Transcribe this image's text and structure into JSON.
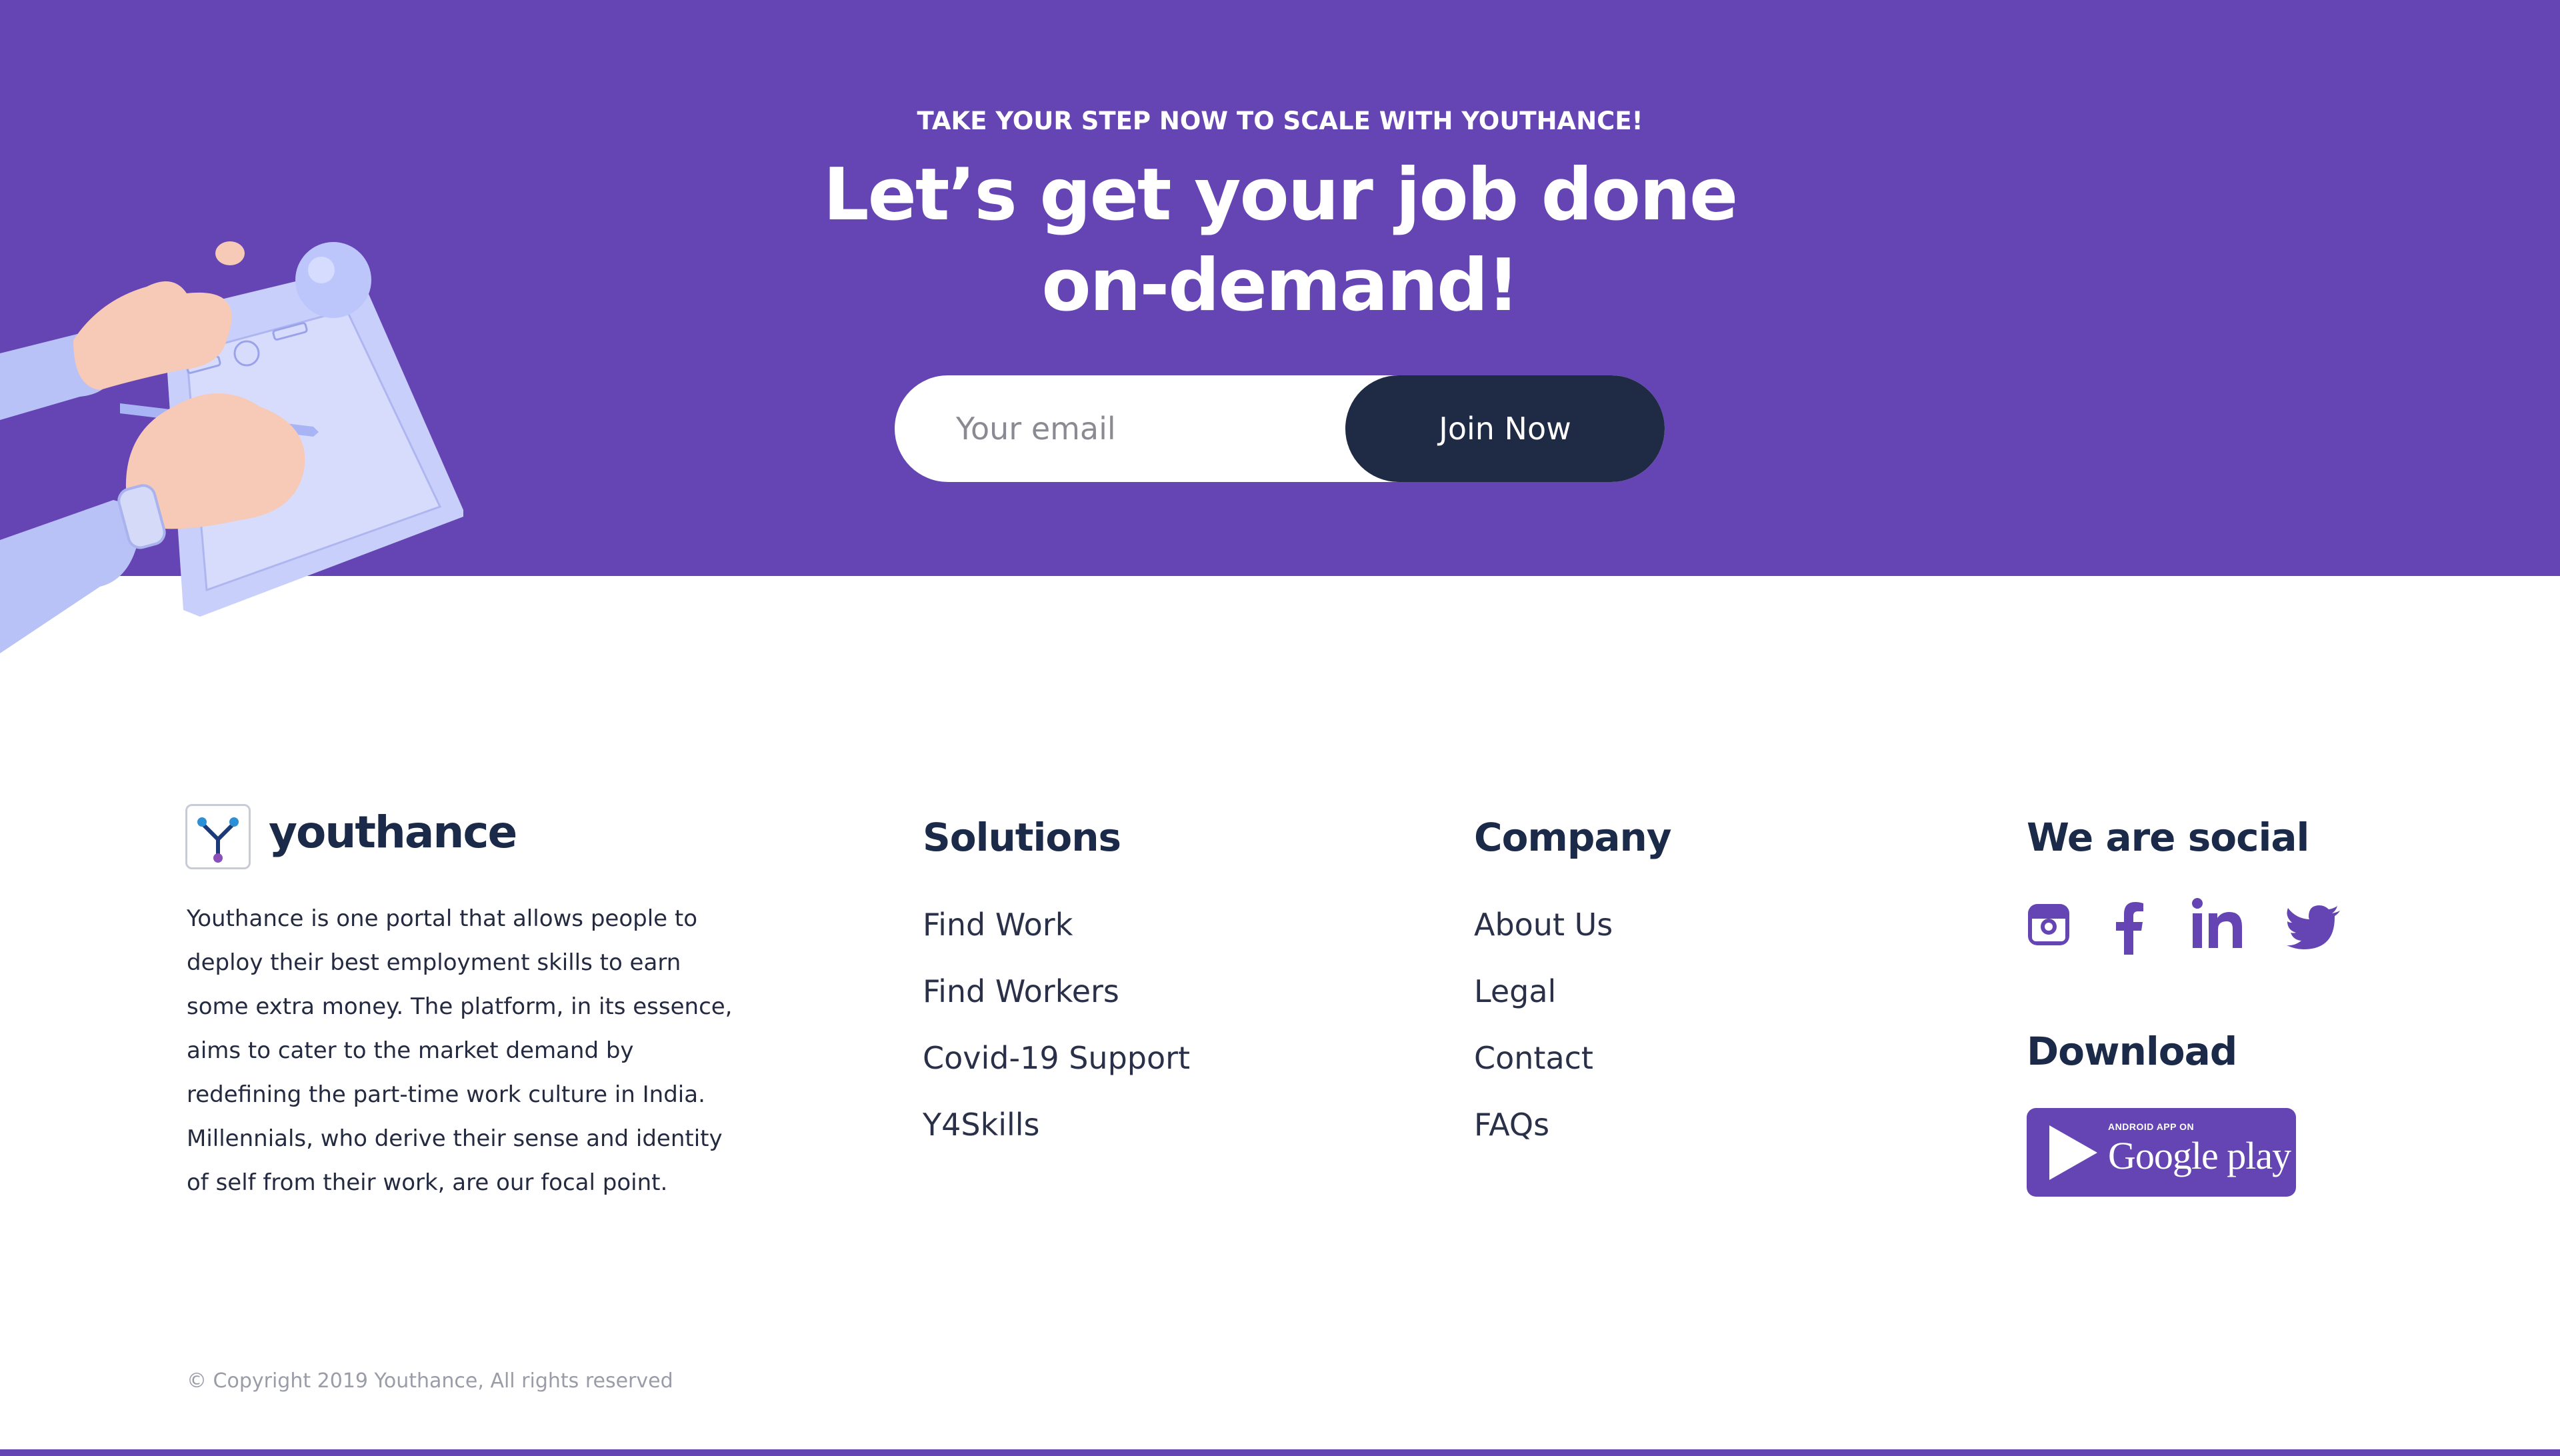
{
  "colors": {
    "brand_purple": "#6545b3",
    "navy": "#1c2a4a",
    "button_dark": "#1f2b45",
    "white": "#ffffff"
  },
  "cta": {
    "eyebrow": "TAKE YOUR STEP NOW TO SCALE WITH YOUTHANCE!",
    "heading_line1": "Let’s get your job done",
    "heading_line2": "on-demand!",
    "email_placeholder": "Your email",
    "email_value": "",
    "join_label": "Join Now"
  },
  "brand": {
    "name": "youthance",
    "description": "Youthance is one portal that allows people to deploy their best employment skills to earn some extra money. The platform, in its essence, aims to cater to the market demand by redefining the part-time work culture in India. Millennials, who derive their sense and identity of self from their work, are our focal point."
  },
  "solutions": {
    "title": "Solutions",
    "items": [
      "Find Work",
      "Find Workers",
      "Covid-19 Support",
      "Y4Skills"
    ]
  },
  "company": {
    "title": "Company",
    "items": [
      "About Us",
      "Legal",
      "Contact",
      "FAQs"
    ]
  },
  "social": {
    "title": "We are social",
    "icons": [
      "instagram-icon",
      "facebook-icon",
      "linkedin-icon",
      "twitter-icon"
    ]
  },
  "download": {
    "title": "Download",
    "badge_small": "ANDROID APP ON",
    "badge_big": "Google play"
  },
  "footer": {
    "copyright": "© Copyright 2019 Youthance, All rights reserved"
  }
}
